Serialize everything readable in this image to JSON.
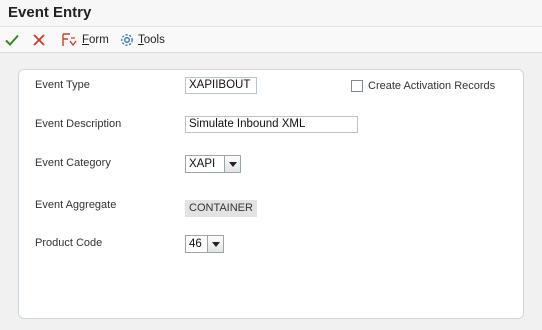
{
  "header": {
    "title": "Event Entry"
  },
  "toolbar": {
    "ok": {
      "icon": "check-icon",
      "color": "#2e8b1e"
    },
    "cancel": {
      "icon": "close-icon",
      "color": "#d23b2a"
    },
    "form_label": "Form",
    "tools_label": "Tools"
  },
  "form": {
    "event_type": {
      "label": "Event Type",
      "value": "XAPIIBOUT"
    },
    "create_activation": {
      "label": "Create Activation Records",
      "checked": false
    },
    "event_description": {
      "label": "Event Description",
      "value": "Simulate Inbound XML"
    },
    "event_category": {
      "label": "Event Category",
      "value": "XAPI"
    },
    "event_aggregate": {
      "label": "Event Aggregate",
      "value": "CONTAINER"
    },
    "product_code": {
      "label": "Product Code",
      "value": "46"
    }
  }
}
